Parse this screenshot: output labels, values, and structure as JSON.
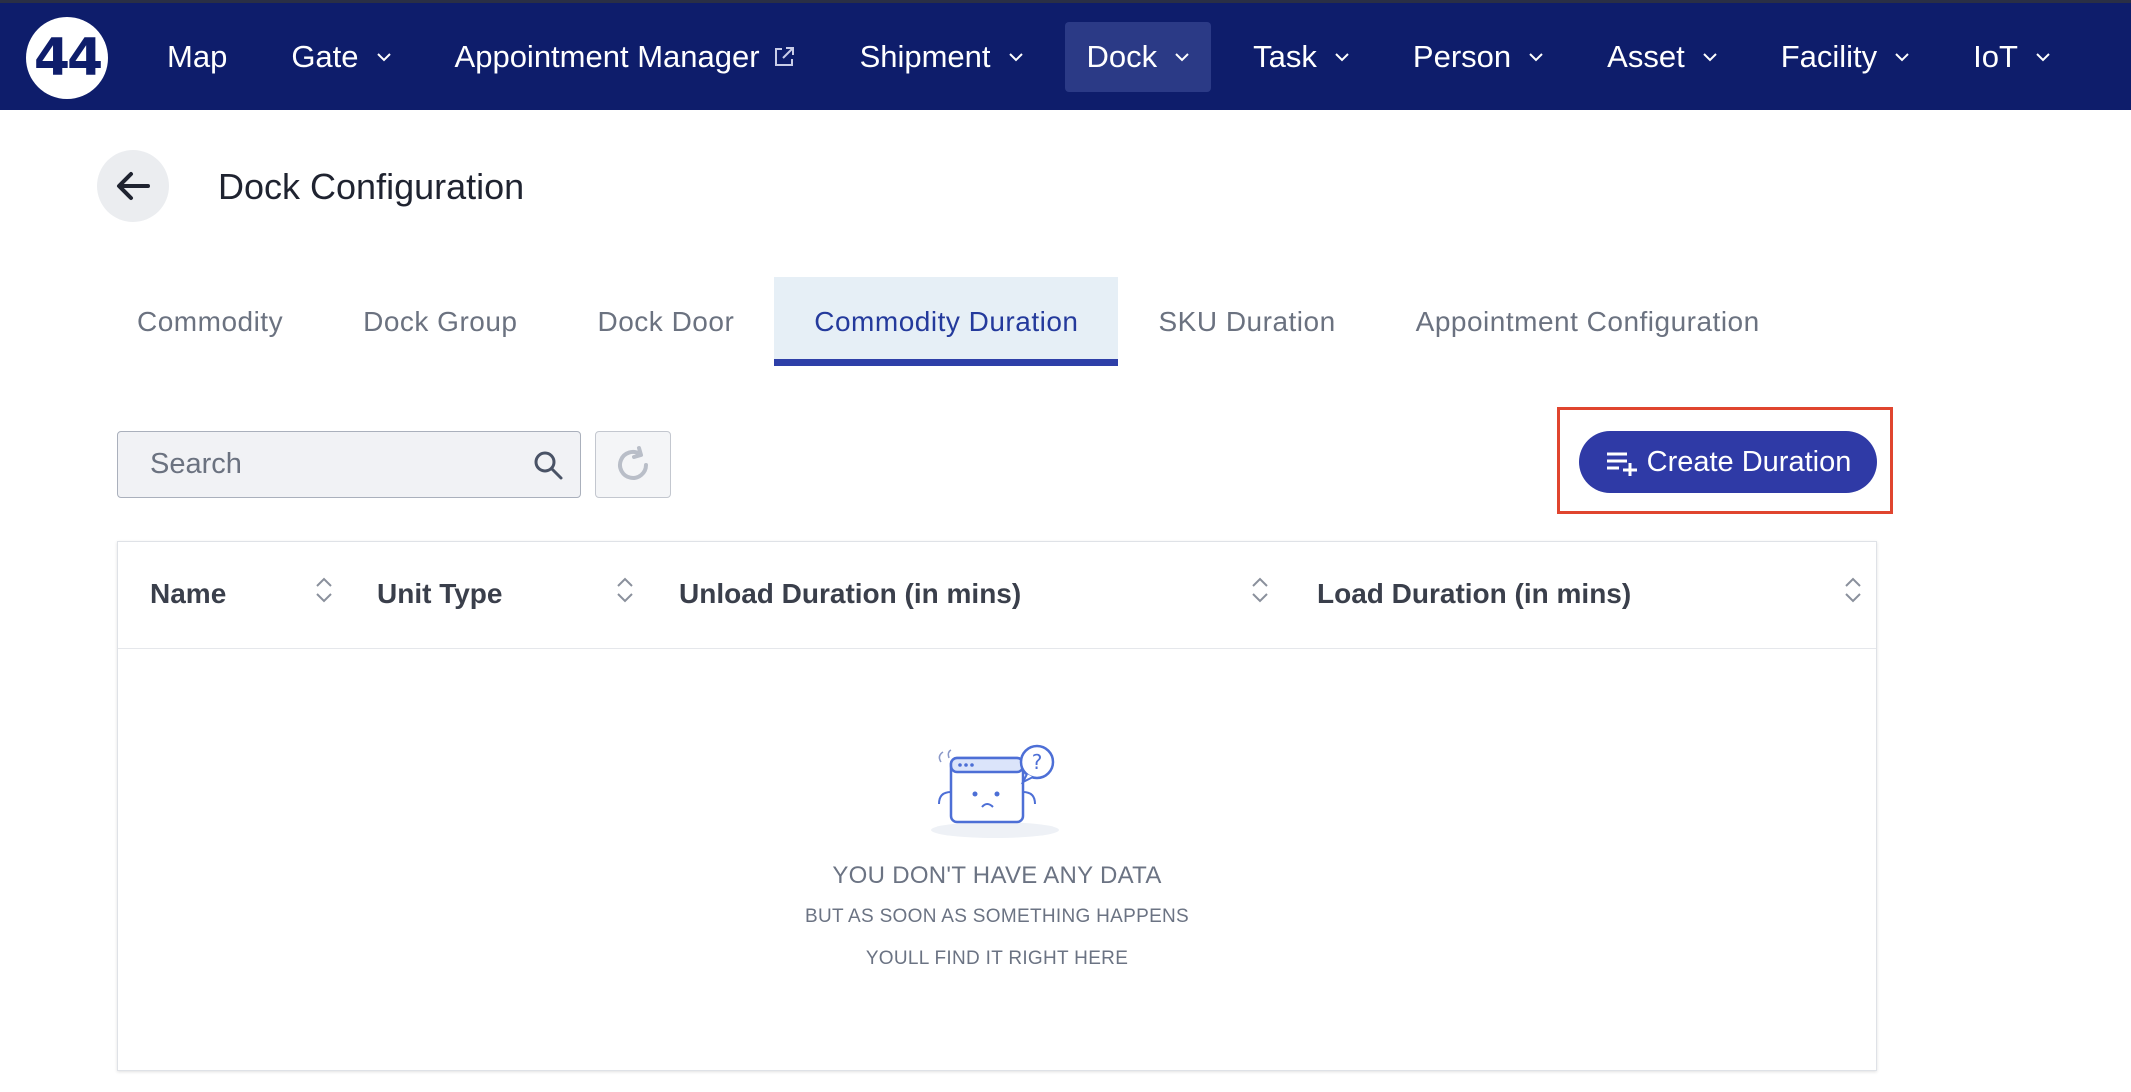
{
  "nav": {
    "logo_text": "44",
    "items": [
      {
        "label": "Map",
        "dropdown": false
      },
      {
        "label": "Gate",
        "dropdown": true
      },
      {
        "label": "Appointment Manager",
        "external": true
      },
      {
        "label": "Shipment",
        "dropdown": true
      },
      {
        "label": "Dock",
        "dropdown": true,
        "active": true
      },
      {
        "label": "Task",
        "dropdown": true
      },
      {
        "label": "Person",
        "dropdown": true
      },
      {
        "label": "Asset",
        "dropdown": true
      },
      {
        "label": "Facility",
        "dropdown": true
      },
      {
        "label": "IoT",
        "dropdown": true
      }
    ]
  },
  "header": {
    "title": "Dock Configuration"
  },
  "tabs": [
    {
      "label": "Commodity"
    },
    {
      "label": "Dock Group"
    },
    {
      "label": "Dock Door"
    },
    {
      "label": "Commodity Duration",
      "active": true
    },
    {
      "label": "SKU Duration"
    },
    {
      "label": "Appointment Configuration"
    }
  ],
  "toolbar": {
    "search_placeholder": "Search",
    "create_label": "Create Duration"
  },
  "table": {
    "columns": [
      {
        "label": "Name"
      },
      {
        "label": "Unit Type"
      },
      {
        "label": "Unload Duration (in mins)"
      },
      {
        "label": "Load Duration (in mins)"
      }
    ],
    "empty": {
      "title": "YOU DON'T HAVE ANY DATA",
      "line1": "BUT AS SOON AS SOMETHING HAPPENS",
      "line2": "YOULL FIND IT RIGHT HERE"
    }
  },
  "colors": {
    "nav_bg": "#0e1d6b",
    "accent": "#2f3aa6",
    "highlight": "#e0452f",
    "active_tab_bg": "#e6eff6"
  }
}
